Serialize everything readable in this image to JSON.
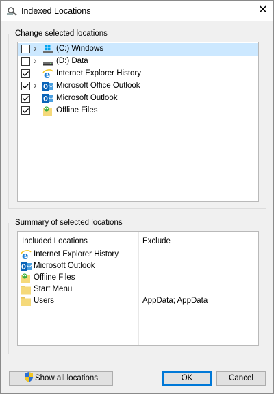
{
  "window": {
    "title": "Indexed Locations",
    "close_glyph": "✕"
  },
  "change_group": {
    "label": "Change selected locations",
    "items": [
      {
        "label": "(C:) Windows",
        "checked": false,
        "expandable": true,
        "icon": "windows-drive-icon",
        "selected": true
      },
      {
        "label": "(D:) Data",
        "checked": false,
        "expandable": true,
        "icon": "drive-icon",
        "selected": false
      },
      {
        "label": "Internet Explorer History",
        "checked": true,
        "expandable": false,
        "icon": "internet-explorer-icon",
        "selected": false
      },
      {
        "label": "Microsoft Office Outlook",
        "checked": true,
        "expandable": true,
        "icon": "outlook-icon",
        "selected": false
      },
      {
        "label": "Microsoft Outlook",
        "checked": true,
        "expandable": false,
        "icon": "outlook-icon",
        "selected": false
      },
      {
        "label": "Offline Files",
        "checked": true,
        "expandable": false,
        "icon": "offline-files-icon",
        "selected": false
      }
    ]
  },
  "summary_group": {
    "label": "Summary of selected locations",
    "col_included": "Included Locations",
    "col_exclude": "Exclude",
    "rows": [
      {
        "label": "Internet Explorer History",
        "exclude": "",
        "icon": "internet-explorer-icon"
      },
      {
        "label": "Microsoft Outlook",
        "exclude": "",
        "icon": "outlook-icon"
      },
      {
        "label": "Offline Files",
        "exclude": "",
        "icon": "offline-files-icon"
      },
      {
        "label": "Start Menu",
        "exclude": "",
        "icon": "folder-icon"
      },
      {
        "label": "Users",
        "exclude": "AppData; AppData",
        "icon": "folder-icon"
      }
    ]
  },
  "buttons": {
    "show_all": "Show all locations",
    "ok": "OK",
    "cancel": "Cancel"
  },
  "colors": {
    "selection": "#cce8ff",
    "accent": "#0078d7",
    "folder": "#f5d97a"
  }
}
